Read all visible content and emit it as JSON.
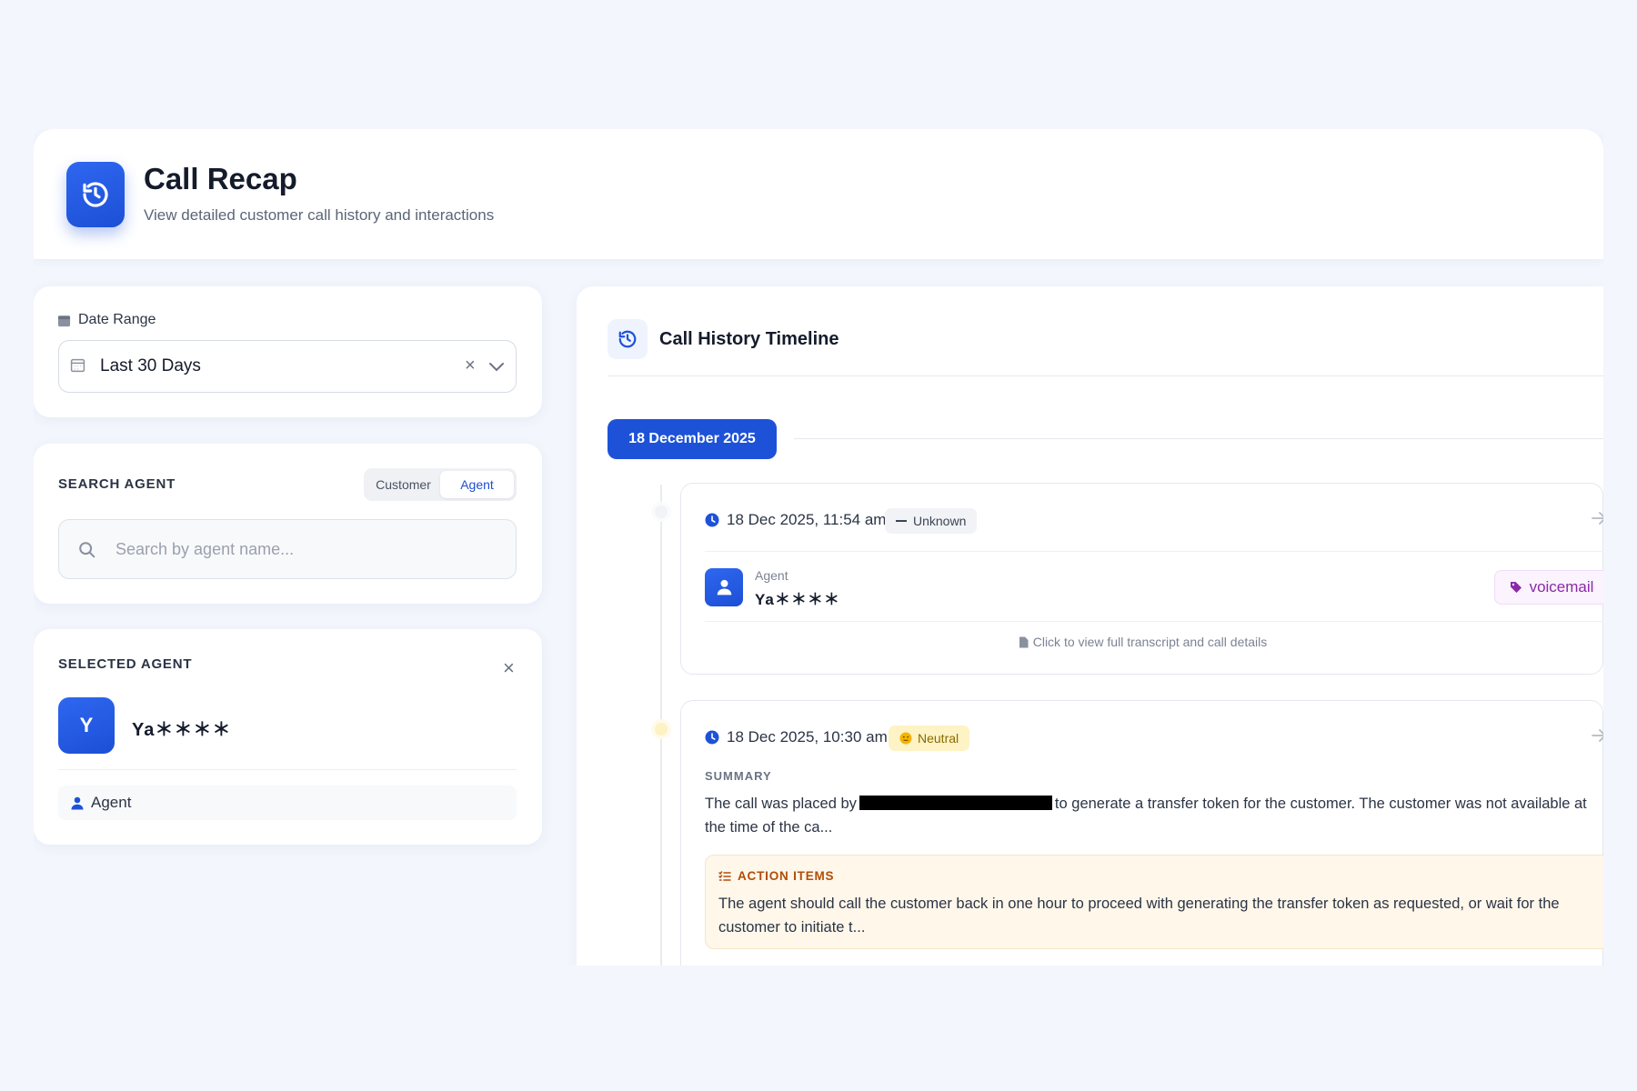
{
  "header": {
    "title": "Call Recap",
    "subtitle": "View detailed customer call history and interactions",
    "icon": "history-icon",
    "accent": "#1d52d8"
  },
  "date_range": {
    "label": "Date Range",
    "value": "Last 30 Days",
    "clear": "×"
  },
  "search": {
    "label": "SEARCH AGENT",
    "toggle": [
      {
        "label": "Customer",
        "active": false
      },
      {
        "label": "Agent",
        "active": true
      }
    ],
    "placeholder": "Search by agent name...",
    "value": ""
  },
  "selected_agent": {
    "label": "SELECTED AGENT",
    "close": "×",
    "initial": "Y",
    "name": "Ya＊＊＊＊",
    "role": "Agent"
  },
  "timeline": {
    "title": "Call History Timeline",
    "date_group": "18 December 2025",
    "calls": [
      {
        "time": "18 Dec 2025, 11:54 am",
        "sentiment": "Unknown",
        "agent_role": "Agent",
        "agent_name": "Ya＊＊＊＊",
        "tag": "voicemail",
        "transcript_link": "Click to view full transcript and call details"
      },
      {
        "time": "18 Dec 2025, 10:30 am",
        "sentiment": "Neutral",
        "summary_label": "SUMMARY",
        "summary_before": "The call was placed by",
        "summary_after": "to generate a transfer token for the customer. The customer was not available at the time of the ca...",
        "action_label": "ACTION ITEMS",
        "action_text": "The agent should call the customer back in one hour to proceed with generating the transfer token as requested, or wait for the customer to initiate t..."
      }
    ]
  }
}
